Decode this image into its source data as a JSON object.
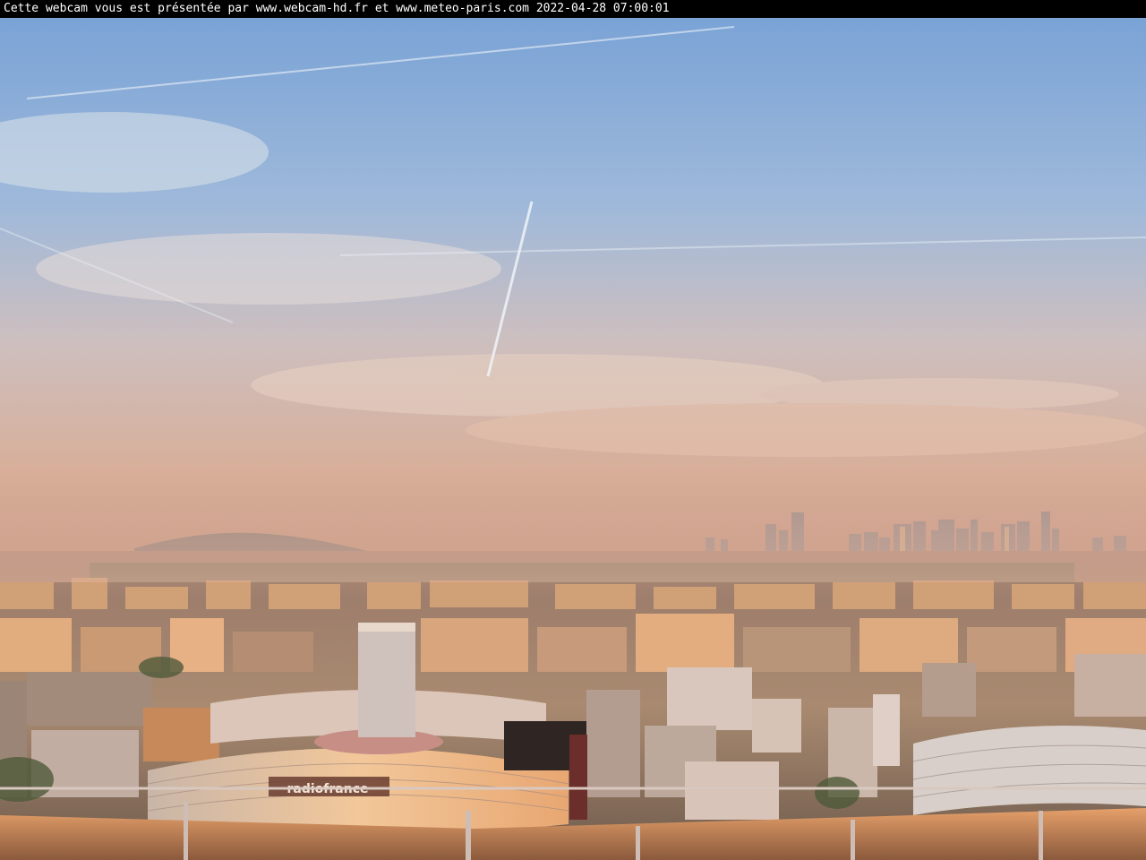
{
  "overlay": {
    "caption": "Cette webcam vous est présentée par www.webcam-hd.fr et www.meteo-paris.com 2022-04-28 07:00:01"
  },
  "scene": {
    "building_sign": "radiofrance"
  },
  "colors": {
    "sky_top": "#7da6d8",
    "sky_mid": "#b9c8d9",
    "sky_haze": "#d9b7a0",
    "horizon": "#c79a85",
    "sunlit_buildings": "#e7a869",
    "shadow_buildings": "#7d6a5e",
    "railing": "#c7885a"
  }
}
